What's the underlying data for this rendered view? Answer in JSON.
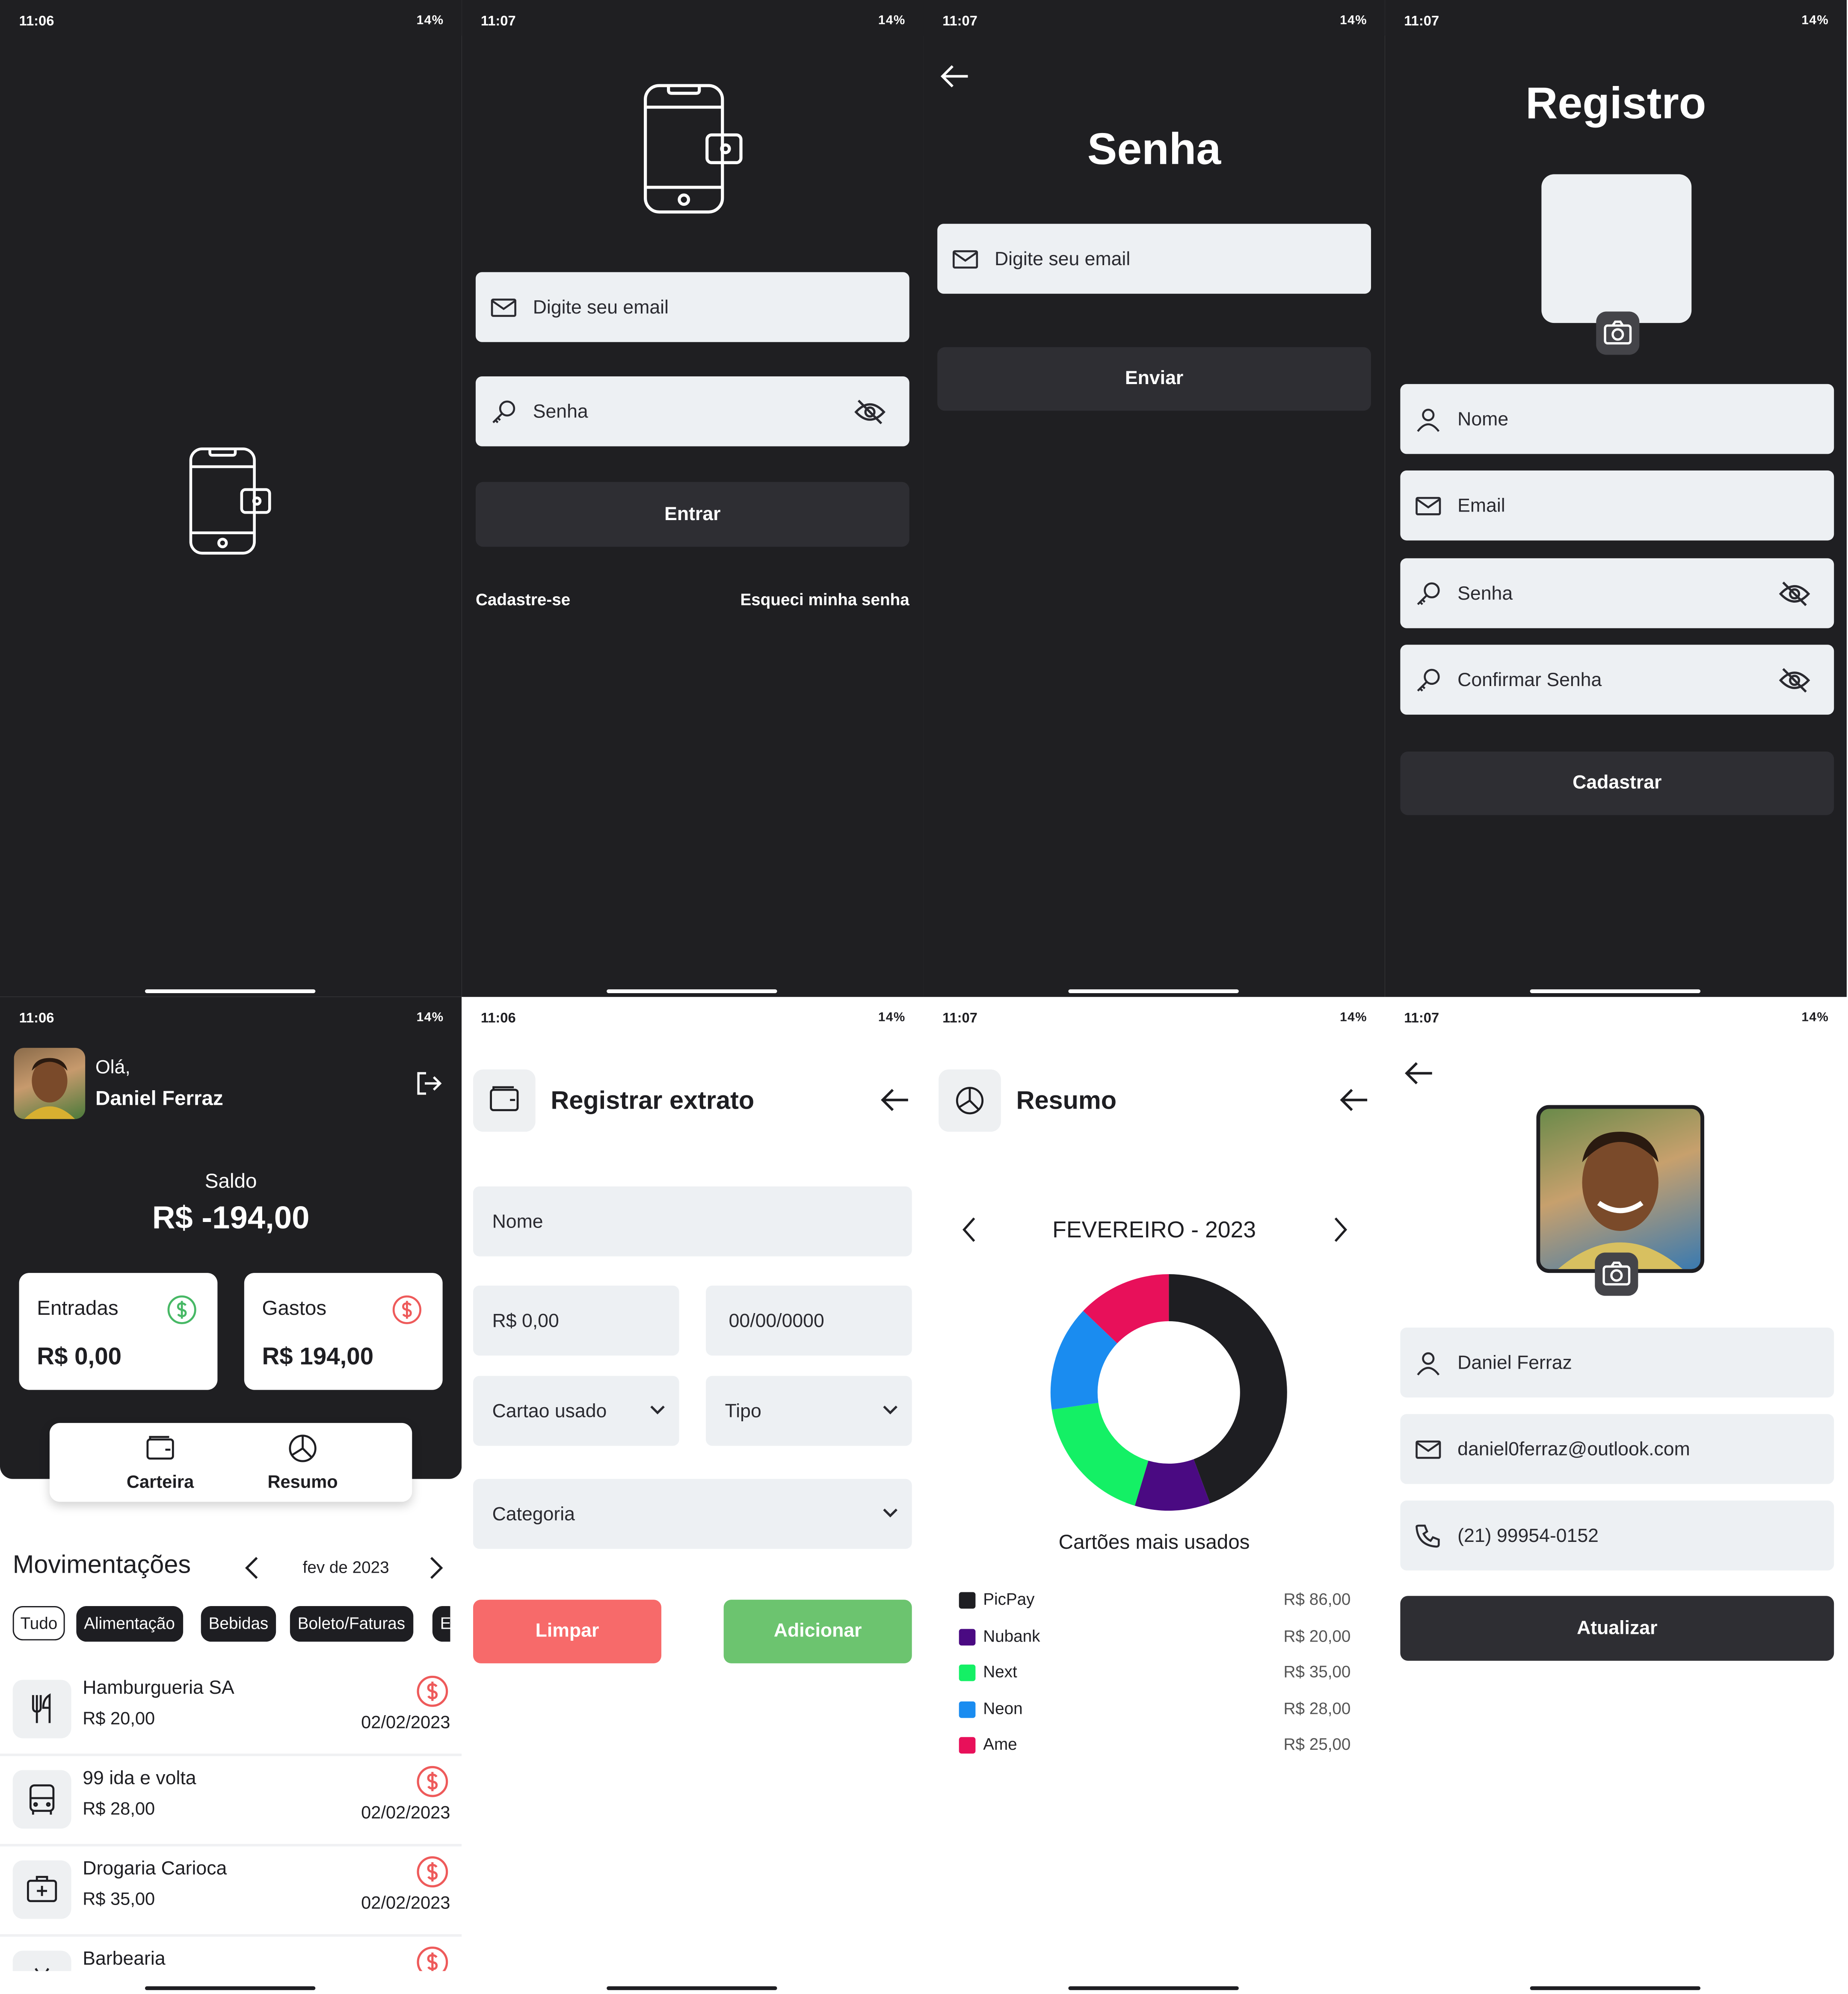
{
  "status": {
    "s1_time": "11:06",
    "s2_time": "11:07",
    "s3_time": "11:07",
    "s4_time": "11:07",
    "s5_time": "11:06",
    "s6_time": "11:06",
    "s7_time": "11:07",
    "s8_time": "11:07",
    "battery": "14%"
  },
  "login": {
    "email_placeholder": "Digite seu email",
    "password_placeholder": "Senha",
    "enter_label": "Entrar",
    "signup_link": "Cadastre-se",
    "forgot_link": "Esqueci minha senha"
  },
  "forgot": {
    "title": "Senha",
    "email_placeholder": "Digite seu email",
    "send_label": "Enviar"
  },
  "register": {
    "title": "Registro",
    "name_placeholder": "Nome",
    "email_placeholder": "Email",
    "password_placeholder": "Senha",
    "confirm_placeholder": "Confirmar Senha",
    "submit_label": "Cadastrar"
  },
  "home": {
    "greeting": "Olá,",
    "user_name": "Daniel Ferraz",
    "balance_label": "Saldo",
    "balance_value": "R$ -194,00",
    "income_label": "Entradas",
    "income_value": "R$ 0,00",
    "expense_label": "Gastos",
    "expense_value": "R$ 194,00",
    "nav_wallet": "Carteira",
    "nav_summary": "Resumo",
    "movements_title": "Movimentações",
    "month": "fev de 2023",
    "chips": [
      "Tudo",
      "Alimentação",
      "Bebidas",
      "Boleto/Faturas",
      "E"
    ],
    "transactions": [
      {
        "name": "Hamburgueria SA",
        "value": "R$ 20,00",
        "date": "02/02/2023"
      },
      {
        "name": "99 ida e volta",
        "value": "R$ 28,00",
        "date": "02/02/2023"
      },
      {
        "name": "Drogaria Carioca",
        "value": "R$ 35,00",
        "date": "02/02/2023"
      },
      {
        "name": "Barbearia",
        "value": "",
        "date": ""
      }
    ]
  },
  "extract": {
    "title": "Registrar extrato",
    "name_placeholder": "Nome",
    "value_placeholder": "R$ 0,00",
    "date_placeholder": "00/00/0000",
    "card_select": "Cartao usado",
    "type_select": "Tipo",
    "category_select": "Categoria",
    "clear_label": "Limpar",
    "add_label": "Adicionar",
    "colors": {
      "clear": "#f76a6a",
      "add": "#6cc46f"
    }
  },
  "summary": {
    "title": "Resumo",
    "period": "FEVEREIRO - 2023",
    "chart_caption": "Cartões mais usados",
    "legend_values": [
      "R$ 86,00",
      "R$ 20,00",
      "R$ 35,00",
      "R$ 28,00",
      "R$ 25,00"
    ]
  },
  "profile": {
    "name": "Daniel Ferraz",
    "email": "daniel0ferraz@outlook.com",
    "phone": "(21) 99954-0152",
    "update_label": "Atualizar"
  },
  "chart_data": {
    "type": "pie",
    "title": "Cartões mais usados",
    "categories": [
      "PicPay",
      "Nubank",
      "Next",
      "Neon",
      "Ame"
    ],
    "values": [
      86,
      20,
      35,
      28,
      25
    ],
    "colors": [
      "#1e1e22",
      "#4a0a82",
      "#14f065",
      "#1a8cf0",
      "#e8105a"
    ],
    "donut": true
  }
}
